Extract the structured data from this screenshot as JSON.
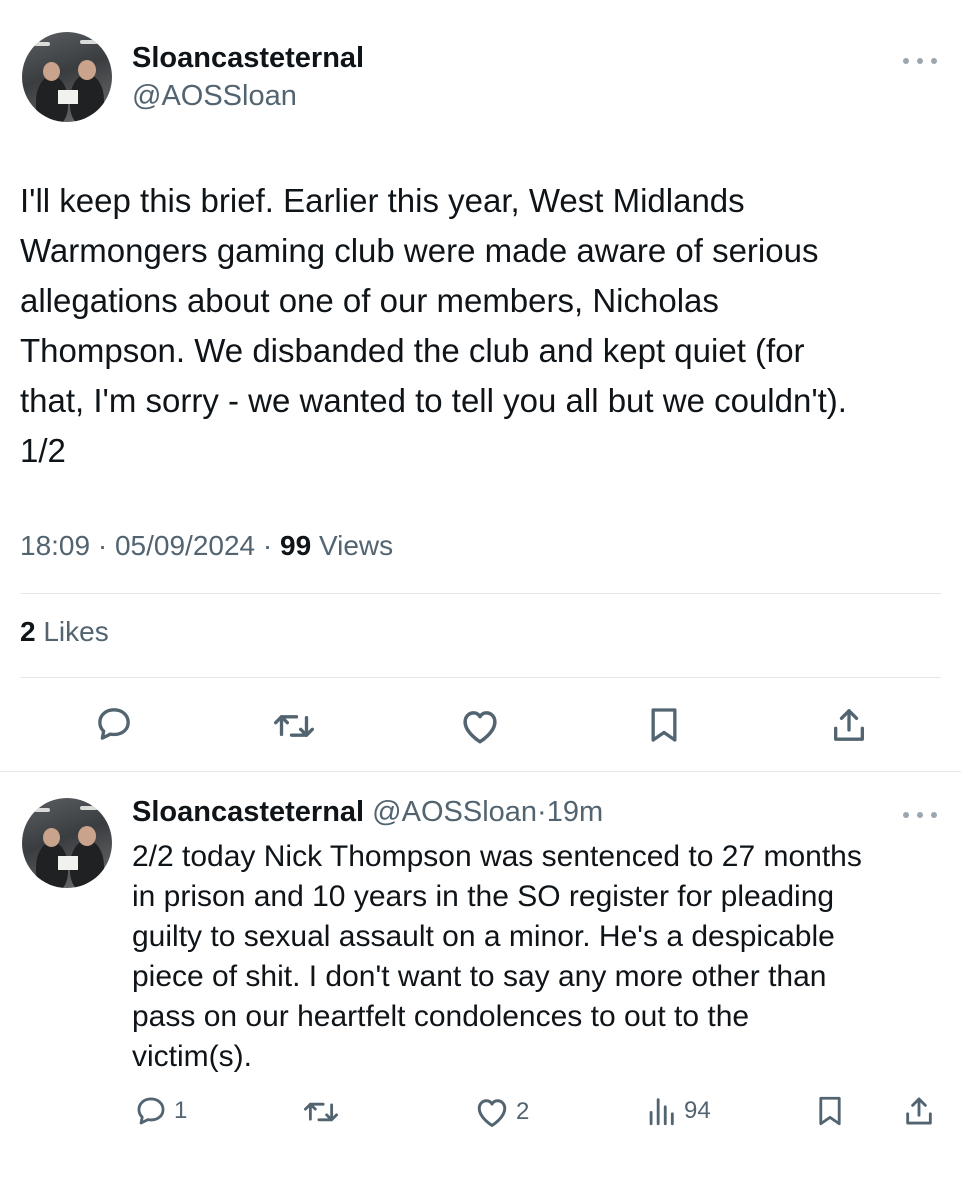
{
  "main_tweet": {
    "author_name": "Sloancasteternal",
    "author_handle": "@AOSSloan",
    "text_lines": [
      "I'll keep this brief. Earlier this year, West Midlands",
      "Warmongers gaming club were made aware of serious",
      "allegations about one of our members, Nicholas",
      "Thompson. We disbanded the club and kept quiet (for",
      "that, I'm sorry - we wanted to tell you all but we couldn't).",
      "1/2"
    ],
    "time": "18:09",
    "date": "05/09/2024",
    "separator": "·",
    "views_count": "99",
    "views_label": "Views",
    "likes_count": "2",
    "likes_label": "Likes",
    "actions": [
      "reply-icon",
      "retweet-icon",
      "like-icon",
      "bookmark-icon",
      "share-icon"
    ]
  },
  "reply_tweet": {
    "author_name": "Sloancasteternal",
    "author_handle": "@AOSSloan",
    "separator": "·",
    "age": "19m",
    "text_lines": [
      "2/2 today Nick Thompson was sentenced to 27 months",
      "in prison and 10 years in the SO register for pleading",
      "guilty to sexual assault on a minor. He's a despicable",
      "piece of shit. I don't want to say any more other than",
      "pass on our heartfelt condolences to out to the",
      "victim(s)."
    ],
    "reply_count": "1",
    "retweet_count": "",
    "like_count": "2",
    "view_count": "94"
  },
  "colors": {
    "text_primary": "#0f1419",
    "text_secondary": "#536471",
    "divider": "#e4e8eb",
    "icon": "#536471"
  }
}
